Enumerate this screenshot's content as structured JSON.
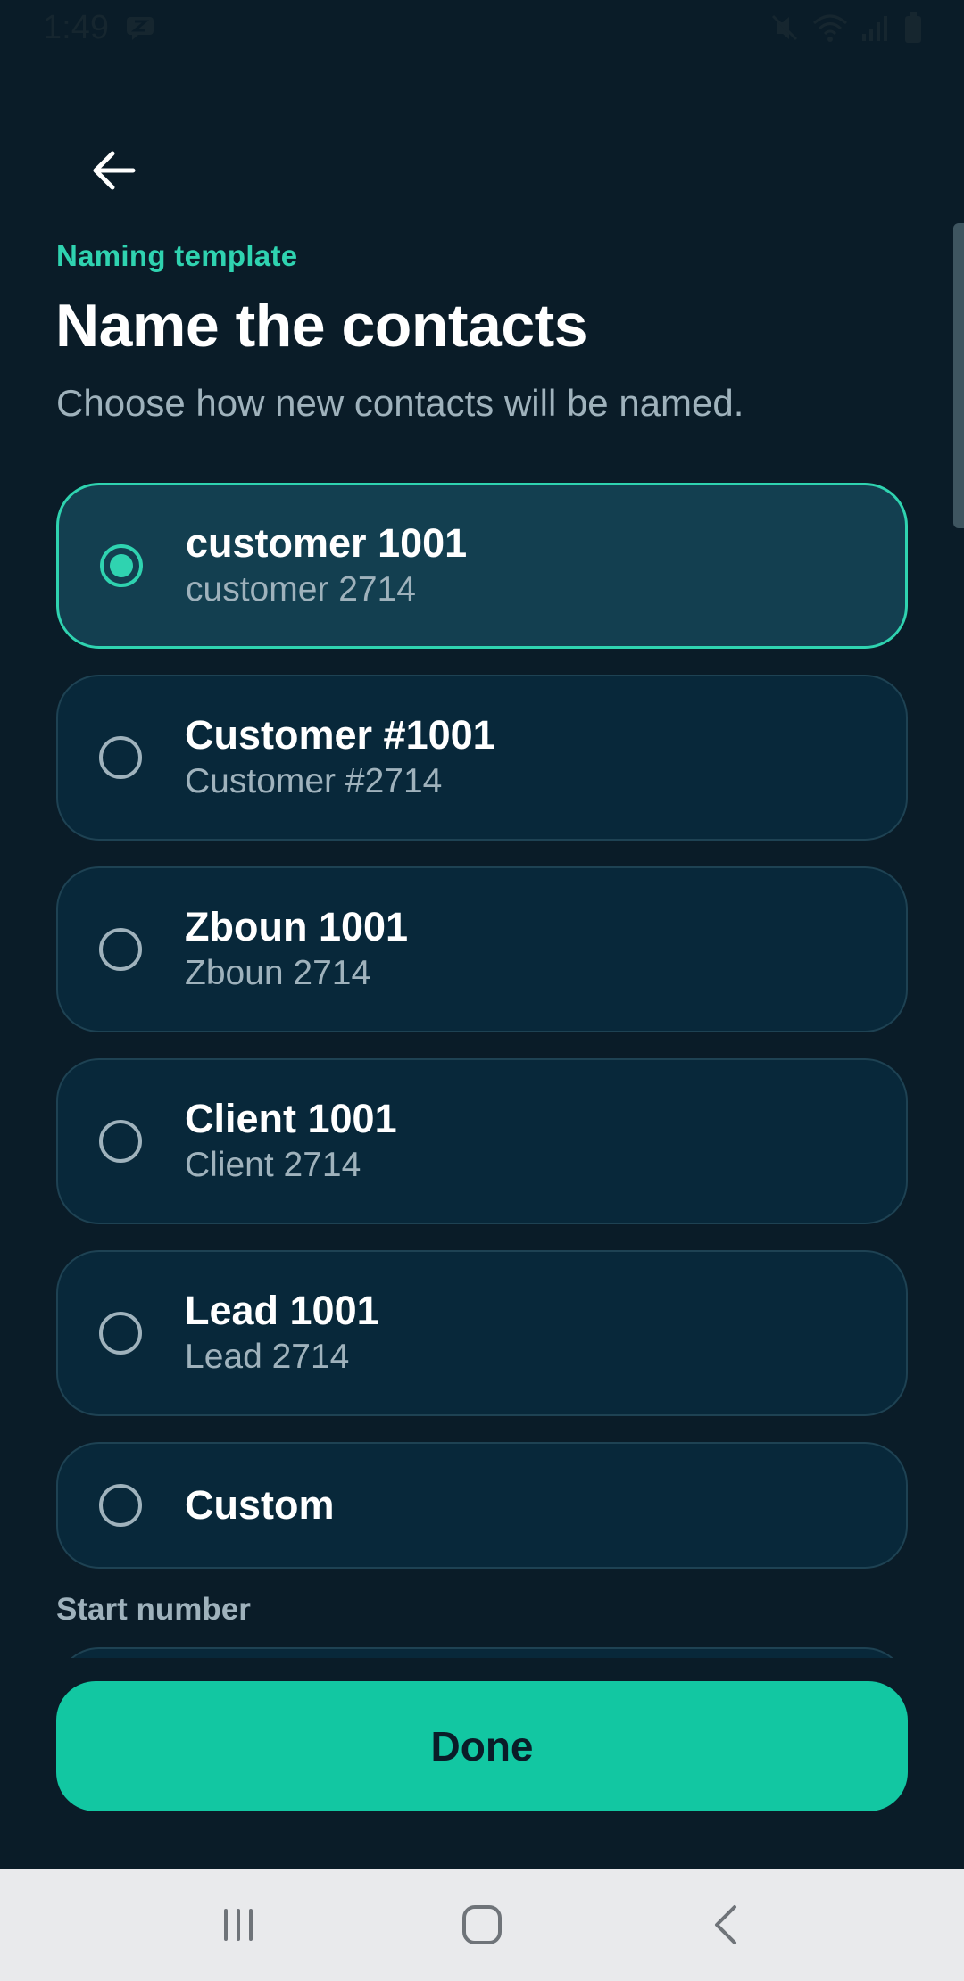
{
  "status_bar": {
    "time": "1:49",
    "icons": [
      "message-icon",
      "mute-icon",
      "wifi-icon",
      "signal-icon",
      "battery-icon"
    ]
  },
  "header": {
    "back_icon": "arrow-left-icon",
    "eyebrow": "Naming template",
    "title": "Name the contacts",
    "subtitle": "Choose how new contacts will be named."
  },
  "options": [
    {
      "title": "customer 1001",
      "example": "customer 2714",
      "selected": true
    },
    {
      "title": "Customer #1001",
      "example": "Customer #2714",
      "selected": false
    },
    {
      "title": "Zboun 1001",
      "example": "Zboun 2714",
      "selected": false
    },
    {
      "title": "Client 1001",
      "example": "Client 2714",
      "selected": false
    },
    {
      "title": "Lead 1001",
      "example": "Lead 2714",
      "selected": false
    },
    {
      "title": "Custom",
      "selected": false
    }
  ],
  "start_number": {
    "label": "Start number"
  },
  "done_button": {
    "label": "Done"
  },
  "nav_bar": {
    "icons": [
      "recent-apps-icon",
      "home-icon",
      "back-icon"
    ]
  },
  "colors": {
    "background": "#0a1c28",
    "accent": "#2fd3b0",
    "button": "#12c7a2",
    "card": "#08283a",
    "card_selected": "#133f50"
  }
}
